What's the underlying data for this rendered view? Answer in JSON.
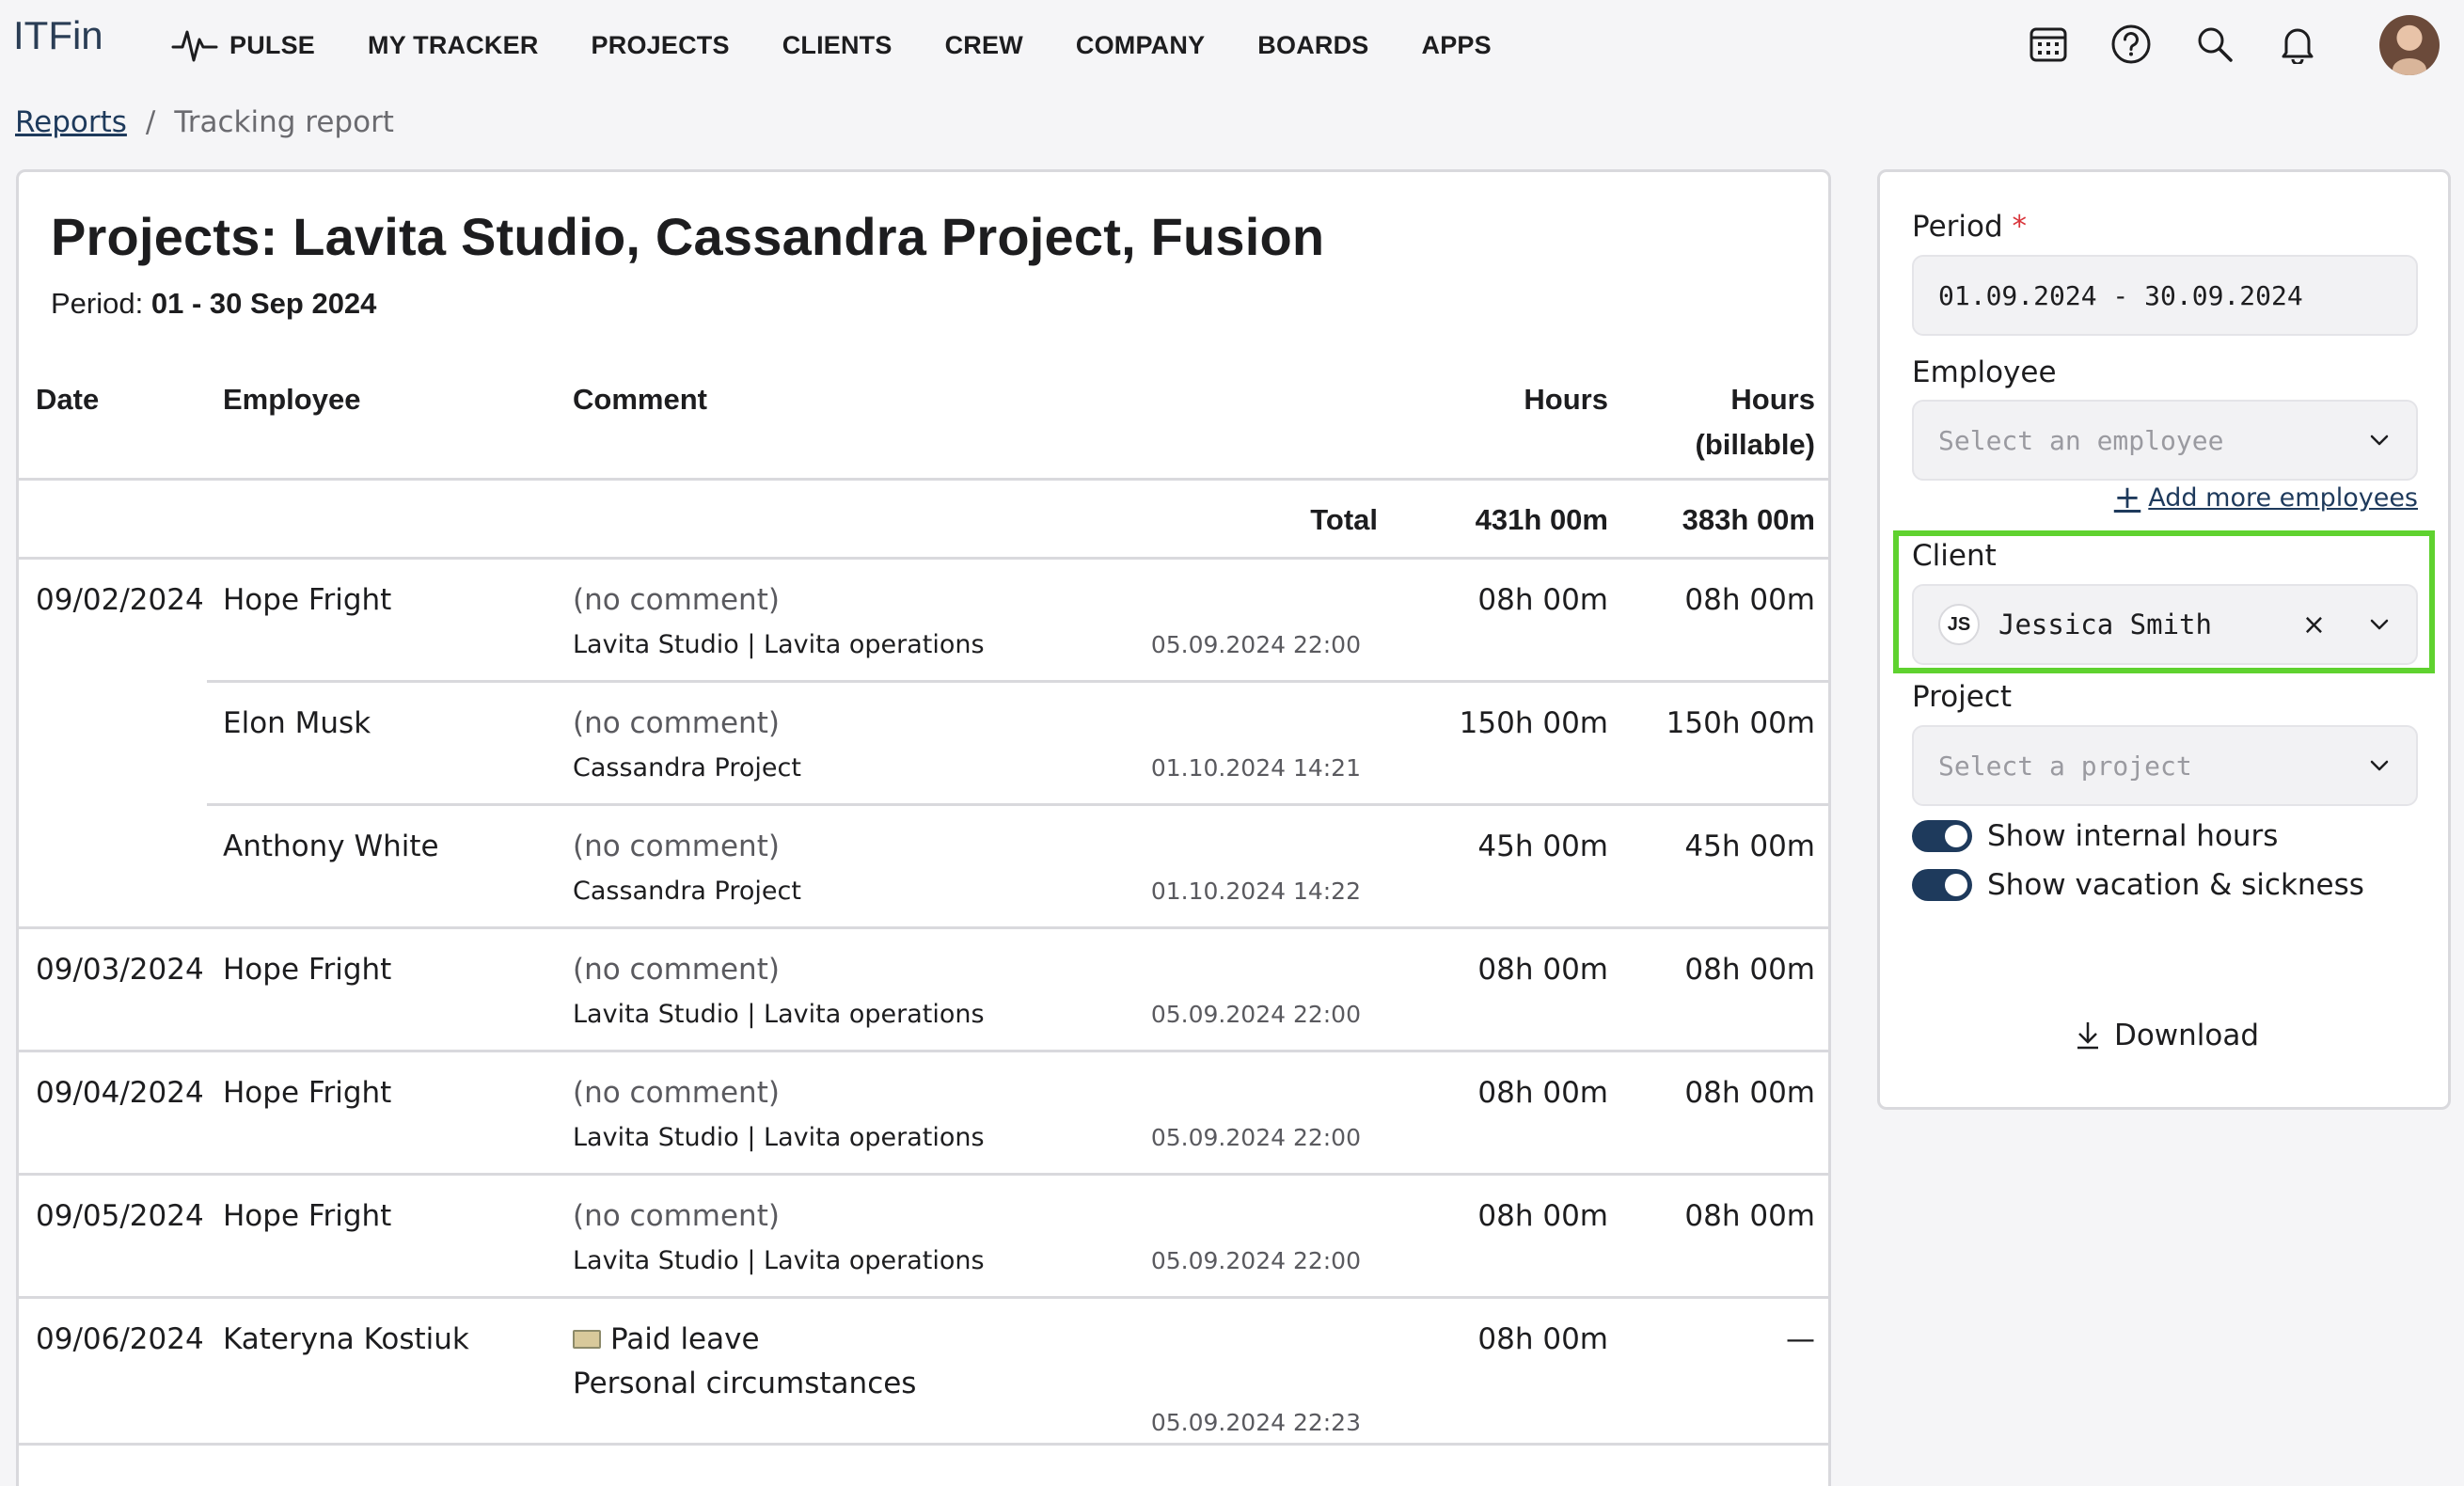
{
  "app": {
    "logo": "ITFin"
  },
  "nav": {
    "items": [
      {
        "label": "PULSE",
        "icon": "pulse-icon"
      },
      {
        "label": "MY TRACKER"
      },
      {
        "label": "PROJECTS"
      },
      {
        "label": "CLIENTS"
      },
      {
        "label": "CREW"
      },
      {
        "label": "COMPANY"
      },
      {
        "label": "BOARDS"
      },
      {
        "label": "APPS"
      }
    ],
    "icons": [
      "calendar-icon",
      "help-icon",
      "search-icon",
      "bell-icon",
      "avatar"
    ]
  },
  "breadcrumb": {
    "parent": "Reports",
    "separator": "/",
    "current": "Tracking report"
  },
  "report": {
    "title": "Projects: Lavita Studio, Cassandra Project, Fusion",
    "period_label": "Period:",
    "period_value": "01 - 30 Sep 2024",
    "columns": {
      "date": "Date",
      "employee": "Employee",
      "comment": "Comment",
      "hours": "Hours",
      "billable_line1": "Hours",
      "billable_line2": "(billable)"
    },
    "total": {
      "label": "Total",
      "hours": "431h 00m",
      "billable": "383h 00m"
    },
    "rows": [
      {
        "date": "09/02/2024",
        "employee": "Hope Fright",
        "comment": "(no comment)",
        "project": "Lavita Studio | Lavita operations",
        "timestamp": "05.09.2024 22:00",
        "hours": "08h 00m",
        "billable": "08h 00m"
      },
      {
        "date": "",
        "employee": "Elon Musk",
        "comment": "(no comment)",
        "project": "Cassandra Project",
        "timestamp": "01.10.2024 14:21",
        "hours": "150h 00m",
        "billable": "150h 00m"
      },
      {
        "date": "",
        "employee": "Anthony White",
        "comment": "(no comment)",
        "project": "Cassandra Project",
        "timestamp": "01.10.2024 14:22",
        "hours": "45h 00m",
        "billable": "45h 00m"
      },
      {
        "date": "09/03/2024",
        "employee": "Hope Fright",
        "comment": "(no comment)",
        "project": "Lavita Studio | Lavita operations",
        "timestamp": "05.09.2024 22:00",
        "hours": "08h 00m",
        "billable": "08h 00m"
      },
      {
        "date": "09/04/2024",
        "employee": "Hope Fright",
        "comment": "(no comment)",
        "project": "Lavita Studio | Lavita operations",
        "timestamp": "05.09.2024 22:00",
        "hours": "08h 00m",
        "billable": "08h 00m"
      },
      {
        "date": "09/05/2024",
        "employee": "Hope Fright",
        "comment": "(no comment)",
        "project": "Lavita Studio | Lavita operations",
        "timestamp": "05.09.2024 22:00",
        "hours": "08h 00m",
        "billable": "08h 00m"
      },
      {
        "date": "09/06/2024",
        "employee": "Kateryna Kostiuk",
        "comment": "Paid leave",
        "comment_icon": "money-icon",
        "project": "Personal circumstances",
        "timestamp": "05.09.2024 22:23",
        "hours": "08h 00m",
        "billable": "—"
      }
    ]
  },
  "filters": {
    "period": {
      "label": "Period",
      "required": "*",
      "value": "01.09.2024 - 30.09.2024"
    },
    "employee": {
      "label": "Employee",
      "placeholder": "Select an employee",
      "add_more": "Add more employees"
    },
    "client": {
      "label": "Client",
      "initials": "JS",
      "value": "Jessica Smith",
      "clear": "×"
    },
    "project": {
      "label": "Project",
      "placeholder": "Select a project"
    },
    "toggles": [
      {
        "label": "Show internal hours",
        "on": true
      },
      {
        "label": "Show vacation & sickness",
        "on": true
      }
    ],
    "download": "Download",
    "highlight_color": "#5fd22f",
    "accent_color": "#1e3a5c"
  }
}
